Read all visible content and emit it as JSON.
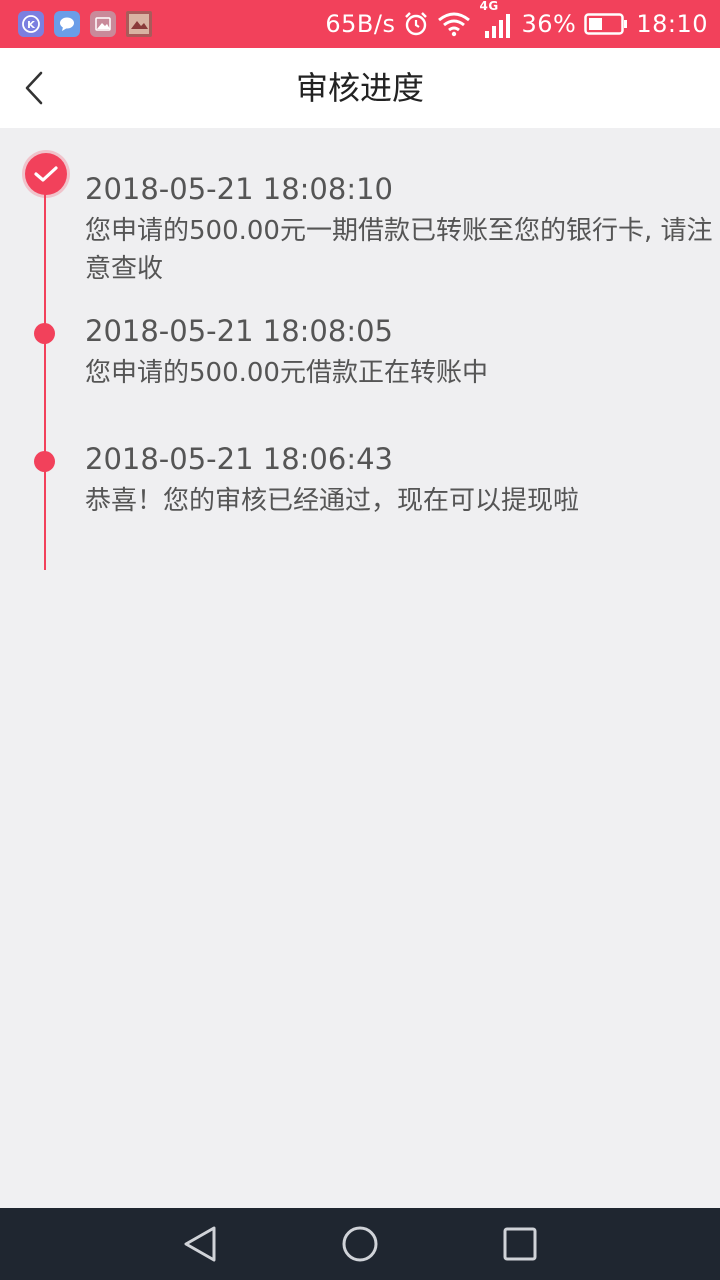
{
  "status_bar": {
    "network_speed": "65B/s",
    "signal_label": "4G",
    "battery": "36%",
    "time": "18:10"
  },
  "header": {
    "title": "审核进度"
  },
  "timeline": [
    {
      "time": "2018-05-21 18:08:10",
      "text": "您申请的500.00元一期借款已转账至您的银行卡, 请注意查收"
    },
    {
      "time": "2018-05-21 18:08:05",
      "text": "您申请的500.00元借款正在转账中"
    },
    {
      "time": "2018-05-21 18:06:43",
      "text": "恭喜！您的审核已经通过，现在可以提现啦"
    }
  ],
  "colors": {
    "accent": "#f2415b",
    "background": "#f0f0f2",
    "nav_bar": "#1f2630"
  }
}
